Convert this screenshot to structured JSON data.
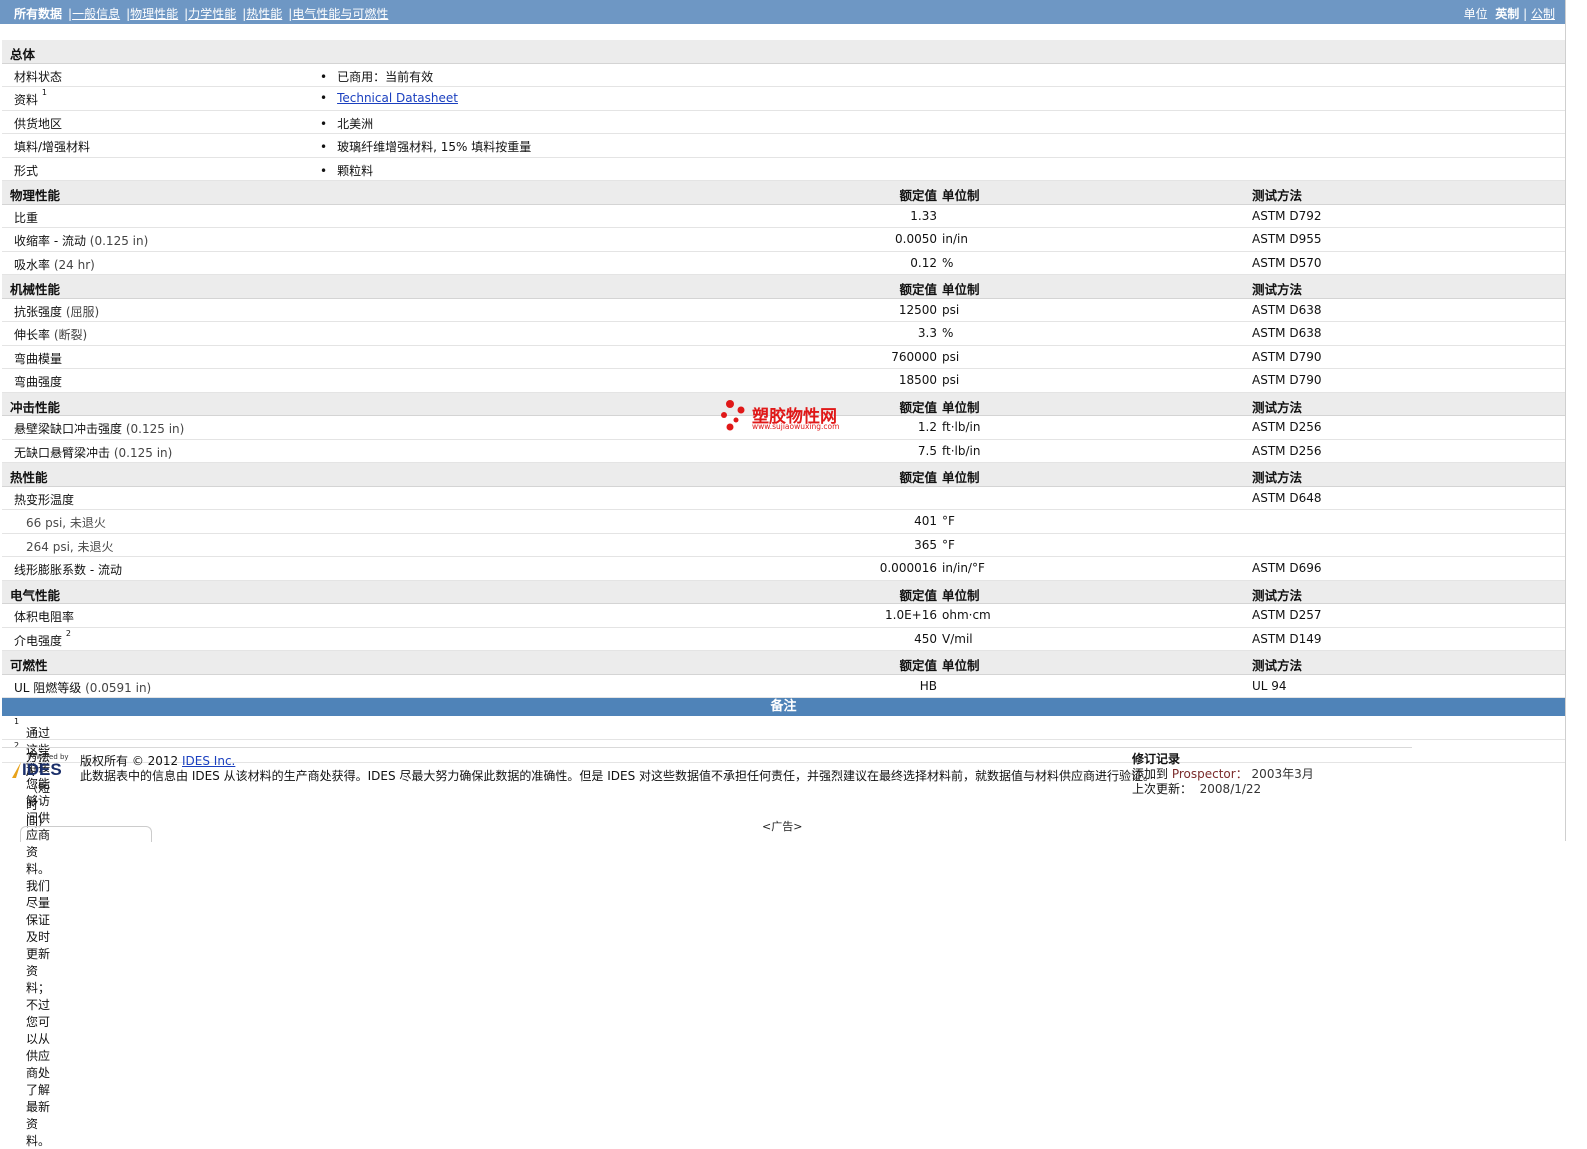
{
  "nav": {
    "tabs": [
      "所有数据",
      "一般信息",
      "物理性能",
      "力学性能",
      "热性能",
      "电气性能与可燃性"
    ],
    "units_label": "单位",
    "unit_english": "英制",
    "unit_metric": "公制"
  },
  "columns": {
    "value": "额定值",
    "unit": "单位制",
    "method": "测试方法"
  },
  "general": {
    "title": "总体",
    "rows": [
      {
        "label": "材料状态",
        "value": "已商用：当前有效"
      },
      {
        "label": "资料",
        "sup": "1",
        "value": "Technical Datasheet"
      },
      {
        "label": "供货地区",
        "value": "北美洲"
      },
      {
        "label": "填料/增强材料",
        "value": "玻璃纤维增强材料, 15% 填料按重量"
      },
      {
        "label": "形式",
        "value": "颗粒料"
      }
    ]
  },
  "physical": {
    "title": "物理性能",
    "rows": [
      {
        "label": "比重",
        "cond": "",
        "value": "1.33",
        "unit": "",
        "method": "ASTM D792"
      },
      {
        "label": "收缩率 - 流动",
        "cond": "(0.125 in)",
        "value": "0.0050",
        "unit": "in/in",
        "method": "ASTM D955"
      },
      {
        "label": "吸水率",
        "cond": "(24 hr)",
        "value": "0.12",
        "unit": "%",
        "method": "ASTM D570"
      }
    ]
  },
  "mechanical": {
    "title": "机械性能",
    "rows": [
      {
        "label": "抗张强度",
        "cond": "(屈服)",
        "value": "12500",
        "unit": "psi",
        "method": "ASTM D638"
      },
      {
        "label": "伸长率",
        "cond": "(断裂)",
        "value": "3.3",
        "unit": "%",
        "method": "ASTM D638"
      },
      {
        "label": "弯曲模量",
        "cond": "",
        "value": "760000",
        "unit": "psi",
        "method": "ASTM D790"
      },
      {
        "label": "弯曲强度",
        "cond": "",
        "value": "18500",
        "unit": "psi",
        "method": "ASTM D790"
      }
    ]
  },
  "impact": {
    "title": "冲击性能",
    "rows": [
      {
        "label": "悬壁梁缺口冲击强度",
        "cond": "(0.125 in)",
        "value": "1.2",
        "unit": "ft·lb/in",
        "method": "ASTM D256"
      },
      {
        "label": "无缺口悬臂梁冲击",
        "cond": "(0.125 in)",
        "value": "7.5",
        "unit": "ft·lb/in",
        "method": "ASTM D256"
      }
    ]
  },
  "thermal": {
    "title": "热性能",
    "hdt_label": "热变形温度",
    "hdt_method": "ASTM D648",
    "sub_rows": [
      {
        "label": "66 psi, 未退火",
        "value": "401",
        "unit": "°F"
      },
      {
        "label": "264 psi, 未退火",
        "value": "365",
        "unit": "°F"
      }
    ],
    "clte": {
      "label": "线形膨胀系数 - 流动",
      "value": "0.000016",
      "unit": "in/in/°F",
      "method": "ASTM D696"
    }
  },
  "electrical": {
    "title": "电气性能",
    "rows": [
      {
        "label": "体积电阻率",
        "sup": "",
        "value": "1.0E+16",
        "unit": "ohm·cm",
        "method": "ASTM D257"
      },
      {
        "label": "介电强度",
        "sup": "2",
        "value": "450",
        "unit": "V/mil",
        "method": "ASTM D149"
      }
    ]
  },
  "flammability": {
    "title": "可燃性",
    "row": {
      "label": "UL 阻燃等级",
      "cond": "(0.0591 in)",
      "value": "HB",
      "unit": "",
      "method": "UL 94"
    }
  },
  "notes": {
    "title": "备注",
    "items": [
      {
        "num": "1",
        "text": "通过这些链接您能够访问供应商资料。我们尽量保证及时更新资料；不过您可以从供应商处了解最新资料。"
      },
      {
        "num": "2",
        "text": "方法A（短时间）"
      }
    ]
  },
  "watermark": {
    "name": "塑胶物性网",
    "url": "www.sujiaowuxing.com"
  },
  "footer": {
    "powered_by": "Powered by",
    "logo_text": "IDES",
    "copyright_prefix": "版权所有 © 2012",
    "copyright_link": "IDES Inc.",
    "disclaimer": "此数据表中的信息由 IDES 从该材料的生产商处获得。IDES 尽最大努力确保此数据的准确性。但是 IDES 对这些数据值不承担任何责任，并强烈建议在最终选择材料前，就数据值与材料供应商进行验证。",
    "revision_title": "修订记录",
    "added_label": "添加到",
    "added_to": "Prospector：",
    "added_date": "2003年3月",
    "updated_label": "上次更新：",
    "updated_date": "2008/1/22",
    "ad": "<广告>"
  }
}
